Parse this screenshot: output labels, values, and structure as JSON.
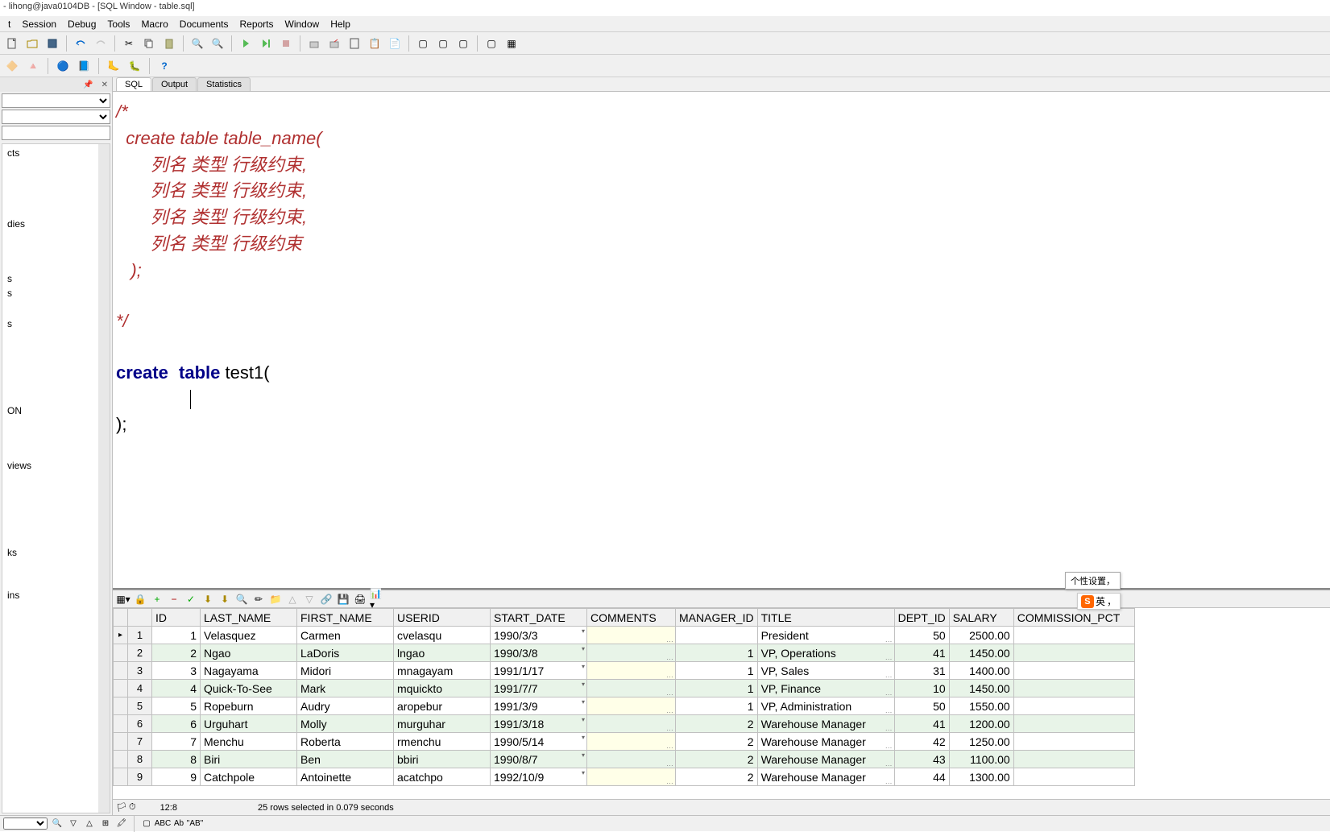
{
  "title": "- lihong@java0104DB - [SQL Window - table.sql]",
  "menus": [
    "t",
    "Session",
    "Debug",
    "Tools",
    "Macro",
    "Documents",
    "Reports",
    "Window",
    "Help"
  ],
  "tabs": {
    "sql": "SQL",
    "output": "Output",
    "statistics": "Statistics"
  },
  "sql": {
    "comment_open": "/*",
    "comment_l1": "  create table table_name(",
    "comment_l2": "       列名 类型 行级约束,",
    "comment_l3": "       列名 类型 行级约束,",
    "comment_l4": "       列名 类型 行级约束,",
    "comment_l5": "       列名 类型 行级约束",
    "comment_l6": "   );",
    "comment_close": "*/",
    "kw_create": "create",
    "kw_table": "table",
    "tname": " test1(",
    "close": ");"
  },
  "sidebar": {
    "items": [
      "cts",
      "dies",
      "s",
      "s",
      "s",
      "ON",
      "views",
      "ks",
      "ins"
    ]
  },
  "columns": [
    "",
    "",
    "ID",
    "LAST_NAME",
    "FIRST_NAME",
    "USERID",
    "START_DATE",
    "COMMENTS",
    "MANAGER_ID",
    "TITLE",
    "DEPT_ID",
    "SALARY",
    "COMMISSION_PCT"
  ],
  "rows": [
    {
      "n": 1,
      "id": 1,
      "last": "Velasquez",
      "first": "Carmen",
      "user": "cvelasqu",
      "date": "1990/3/3",
      "mgr": "",
      "title": "President",
      "dept": 50,
      "sal": "2500.00"
    },
    {
      "n": 2,
      "id": 2,
      "last": "Ngao",
      "first": "LaDoris",
      "user": "lngao",
      "date": "1990/3/8",
      "mgr": "1",
      "title": "VP, Operations",
      "dept": 41,
      "sal": "1450.00"
    },
    {
      "n": 3,
      "id": 3,
      "last": "Nagayama",
      "first": "Midori",
      "user": "mnagayam",
      "date": "1991/1/17",
      "mgr": "1",
      "title": "VP, Sales",
      "dept": 31,
      "sal": "1400.00"
    },
    {
      "n": 4,
      "id": 4,
      "last": "Quick-To-See",
      "first": "Mark",
      "user": "mquickto",
      "date": "1991/7/7",
      "mgr": "1",
      "title": "VP, Finance",
      "dept": 10,
      "sal": "1450.00"
    },
    {
      "n": 5,
      "id": 5,
      "last": "Ropeburn",
      "first": "Audry",
      "user": "aropebur",
      "date": "1991/3/9",
      "mgr": "1",
      "title": "VP, Administration",
      "dept": 50,
      "sal": "1550.00"
    },
    {
      "n": 6,
      "id": 6,
      "last": "Urguhart",
      "first": "Molly",
      "user": "murguhar",
      "date": "1991/3/18",
      "mgr": "2",
      "title": "Warehouse Manager",
      "dept": 41,
      "sal": "1200.00"
    },
    {
      "n": 7,
      "id": 7,
      "last": "Menchu",
      "first": "Roberta",
      "user": "rmenchu",
      "date": "1990/5/14",
      "mgr": "2",
      "title": "Warehouse Manager",
      "dept": 42,
      "sal": "1250.00"
    },
    {
      "n": 8,
      "id": 8,
      "last": "Biri",
      "first": "Ben",
      "user": "bbiri",
      "date": "1990/8/7",
      "mgr": "2",
      "title": "Warehouse Manager",
      "dept": 43,
      "sal": "1100.00"
    },
    {
      "n": 9,
      "id": 9,
      "last": "Catchpole",
      "first": "Antoinette",
      "user": "acatchpo",
      "date": "1992/10/9",
      "mgr": "2",
      "title": "Warehouse Manager",
      "dept": 44,
      "sal": "1300.00"
    }
  ],
  "status": {
    "pos": "12:8",
    "msg": "25 rows selected in 0.079 seconds"
  },
  "find": {
    "abc": "ABC",
    "ab": "Ab",
    "ab2": "\"AB\""
  },
  "ime": {
    "tip": "个性设置，",
    "s": "S",
    "lang": "英",
    "comma": "，"
  }
}
